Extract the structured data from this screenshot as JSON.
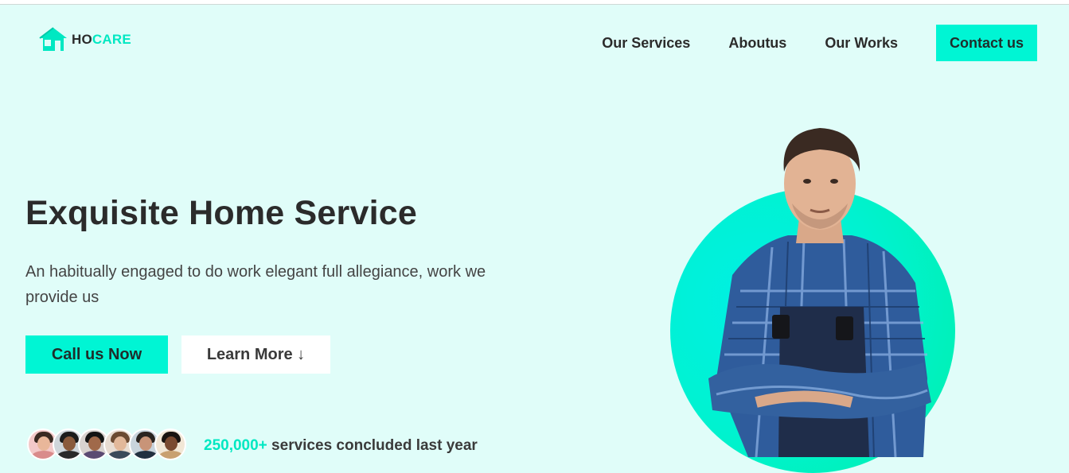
{
  "brand": {
    "prefix": "HO",
    "suffix": "CARE"
  },
  "nav": {
    "items": [
      "Our Services",
      "Aboutus",
      "Our Works"
    ],
    "cta": "Contact us"
  },
  "hero": {
    "title": "Exquisite Home Service",
    "subtitle": "An habitually engaged to do work elegant full allegiance, work we provide us",
    "primary_button": "Call us Now",
    "secondary_button": "Learn More ↓"
  },
  "stats": {
    "number": "250,000+",
    "text": " services concluded last year"
  },
  "colors": {
    "accent": "#00f5d4",
    "background": "#e0fdf9",
    "text": "#2b2b2b"
  },
  "icons": {
    "logo": "house-icon"
  }
}
